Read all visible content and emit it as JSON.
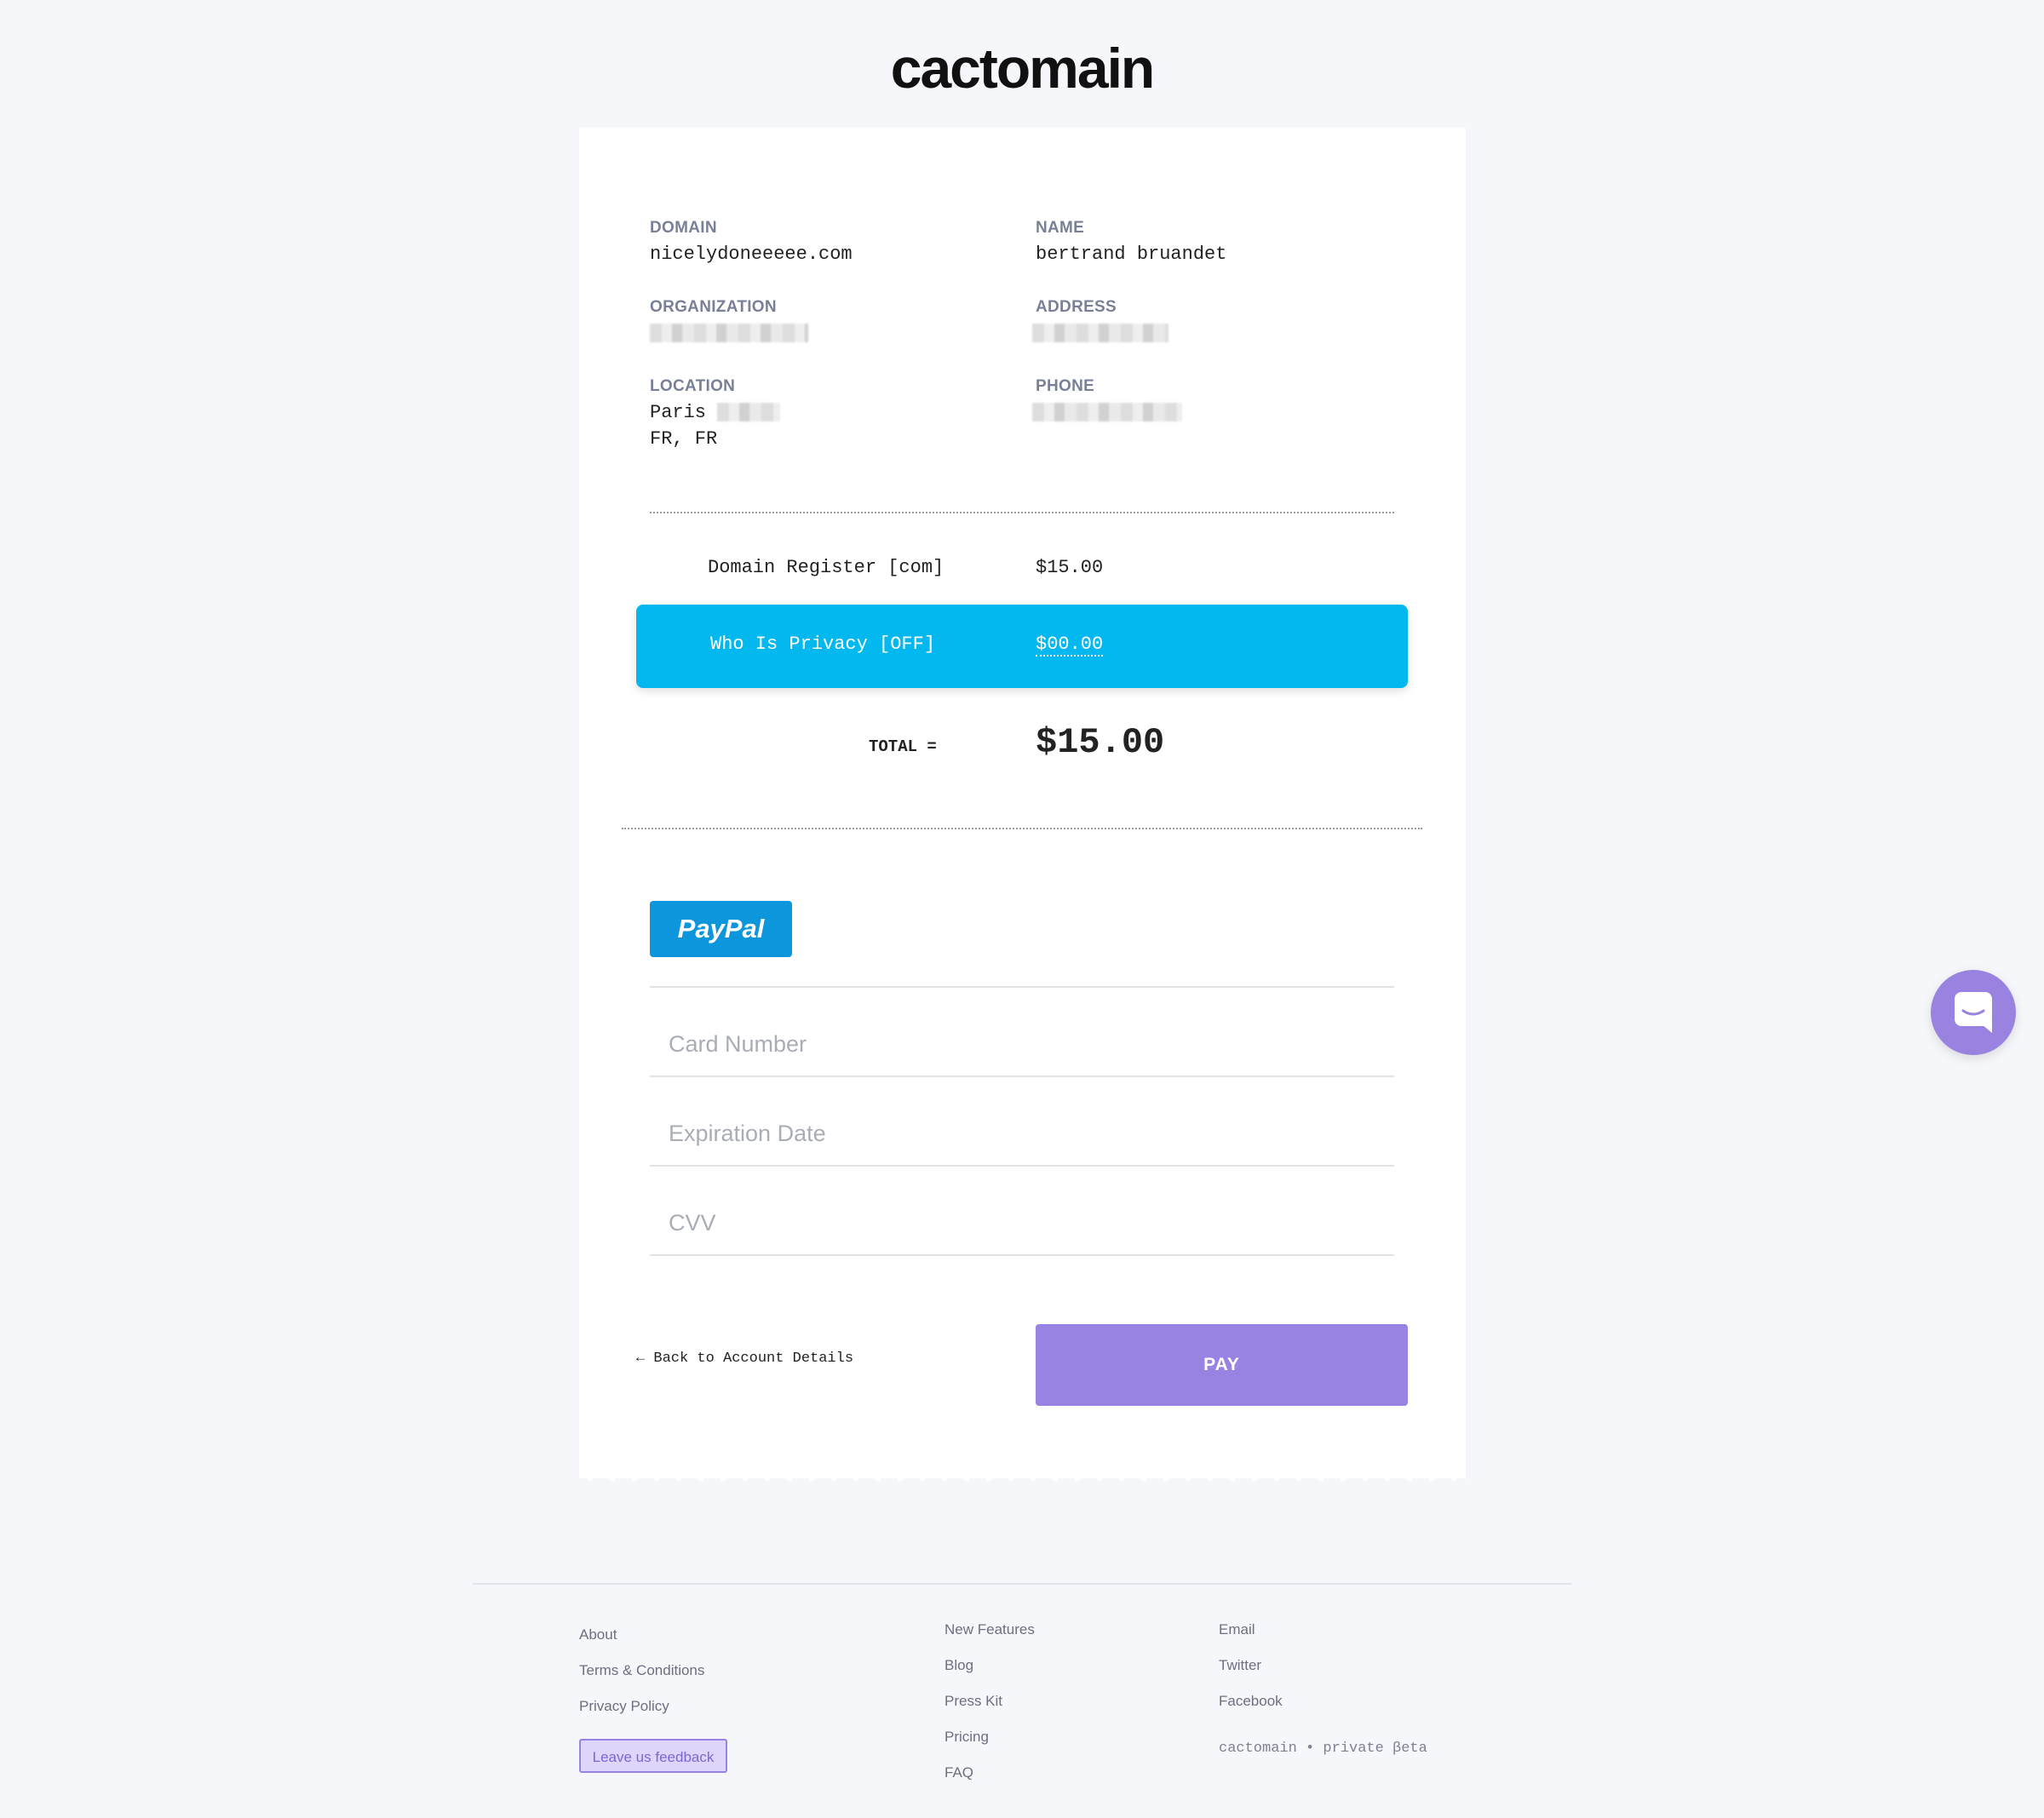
{
  "brand": {
    "logo_text": "cactomain"
  },
  "details": {
    "domain": {
      "label": "DOMAIN",
      "value": "nicelydoneeeee.com"
    },
    "name": {
      "label": "NAME",
      "value": "bertrand bruandet"
    },
    "organization": {
      "label": "ORGANIZATION"
    },
    "address": {
      "label": "ADDRESS"
    },
    "location": {
      "label": "LOCATION",
      "line1": "Paris",
      "line2": "FR, FR"
    },
    "phone": {
      "label": "PHONE"
    }
  },
  "order": {
    "items": [
      {
        "label": "Domain Register [com]",
        "price": "$15.00"
      },
      {
        "label": "Who Is Privacy [OFF]",
        "price": "$00.00"
      }
    ],
    "total_label": "TOTAL =",
    "total_value": "$15.00"
  },
  "payment": {
    "paypal_label": "PayPal",
    "card_number_placeholder": "Card Number",
    "expiration_placeholder": "Expiration Date",
    "cvv_placeholder": "CVV",
    "back_label": "← Back to Account Details",
    "pay_label": "PAY"
  },
  "footer": {
    "col1": [
      "About",
      "Terms & Conditions",
      "Privacy Policy"
    ],
    "feedback_label": "Leave us feedback",
    "col2": [
      "New Features",
      "Blog",
      "Press Kit",
      "Pricing",
      "FAQ"
    ],
    "col3": [
      "Email",
      "Twitter",
      "Facebook"
    ],
    "beta_text": "cactomain • private βeta"
  },
  "colors": {
    "accent": "#9883e2",
    "highlight": "#03b7ef",
    "paypal": "#0d96db",
    "background": "#f6f7fb"
  }
}
